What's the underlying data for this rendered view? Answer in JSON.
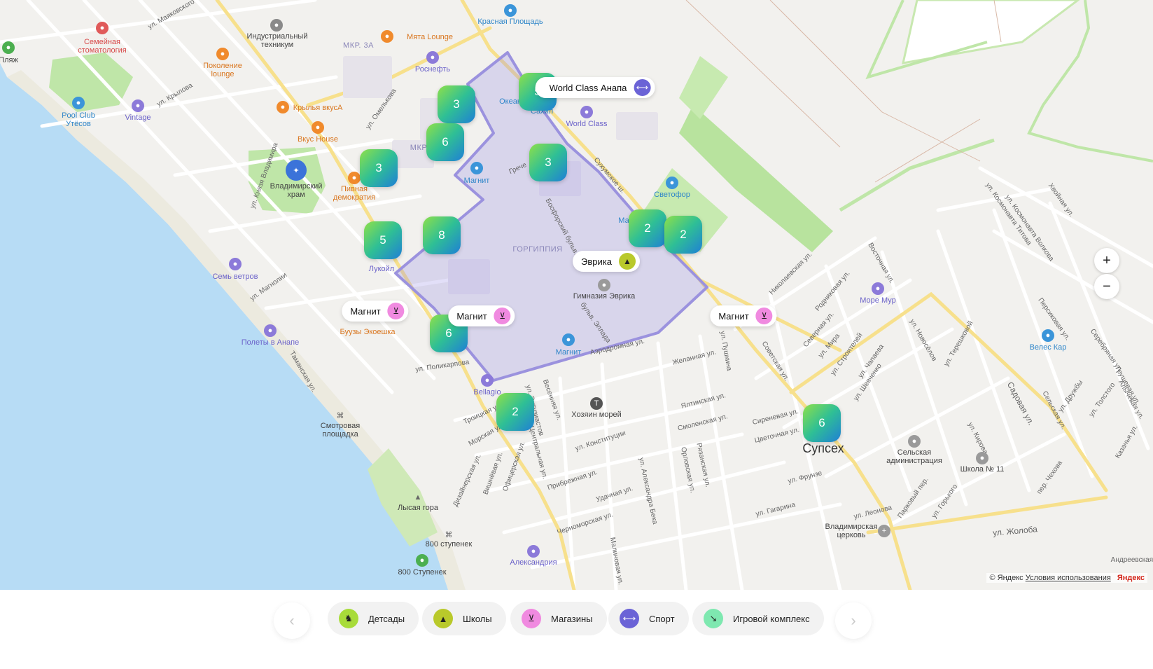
{
  "map": {
    "area_name": "ГОРГИППИЯ",
    "district": "Супсех",
    "clusters": [
      {
        "count": "5"
      },
      {
        "count": "3"
      },
      {
        "count": "6"
      },
      {
        "count": "3"
      },
      {
        "count": "3"
      },
      {
        "count": "5"
      },
      {
        "count": "8"
      },
      {
        "count": "2"
      },
      {
        "count": "2"
      },
      {
        "count": "6"
      },
      {
        "count": "2"
      },
      {
        "count": "6"
      }
    ],
    "tags": [
      {
        "label": "World Class Анапа",
        "icon": "dumbbell-icon",
        "color": "#6b63d6"
      },
      {
        "label": "Эврика",
        "icon": "graduation-cap-icon",
        "color": "#b9c92b"
      },
      {
        "label": "Магнит",
        "icon": "cart-icon",
        "color": "#f08ae0"
      },
      {
        "label": "Магнит",
        "icon": "cart-icon",
        "color": "#f08ae0"
      },
      {
        "label": "Магнит",
        "icon": "cart-icon",
        "color": "#f08ae0"
      }
    ],
    "labels": [
      "Красная Площадь",
      "Мята Lounge",
      "Индустриальный техникум",
      "Семейная стоматология",
      "Поколение lounge",
      "Роснефть",
      "Крылья вкусА",
      "Вкус House",
      "Pool Club Утёсов",
      "Vintage",
      "Владимирский храм",
      "Пивная демократия",
      "Лукойл",
      "Семь ветров",
      "Буузы Экоешка",
      "Полеты в Анапе",
      "Смотровая площадка",
      "Лысая гора",
      "800 ступенек",
      "800 Ступенек",
      "Александрия",
      "Bellagio",
      "Хозяин морей",
      "Магнит",
      "Магнит",
      "Гимназия Эврика",
      "Светофор",
      "World Class",
      "Океан",
      "Сахил",
      "Море Мур",
      "Велес Кар",
      "Сельская администрация",
      "Школа № 11",
      "Владимирская церковь",
      "МКР. 3А",
      "Пляж",
      "Маг",
      "Грече",
      "МКР"
    ],
    "streets": [
      "ул. Маяковского",
      "ул. Крылова",
      "ул. Омелькова",
      "ул. Князя Владимира",
      "ул. Магнолии",
      "Таманская ул.",
      "ул. Поликарпова",
      "Троицкая ул.",
      "Морская ул.",
      "Весенняя ул.",
      "ул. Энтузиастов",
      "Центральная ул.",
      "Офицерская ул.",
      "Вишнёвая ул.",
      "Дизайнерская ул.",
      "Прибрежная ул.",
      "ул. Конституции",
      "Удачная ул.",
      "Черноморская ул.",
      "Малиновая ул.",
      "ул. Александра Бека",
      "Орловская ул.",
      "Рязанская ул.",
      "Смоленская ул.",
      "Ялтинская ул.",
      "Желанная ул.",
      "ул. Пушкина",
      "Советская ул.",
      "Аэродромная ул.",
      "бульв. Эллада",
      "Босфорский бульв.",
      "Сухумское ш.",
      "Николаевская ул.",
      "Родниковая ул.",
      "Северная ул.",
      "ул. Мира",
      "ул. Строителей",
      "ул. Чапаева",
      "ул. Шевченко",
      "Восточная ул.",
      "ул. Новосёлов",
      "ул. Терешковой",
      "Сиреневая ул.",
      "Цветочная ул.",
      "ул. Фрунзе",
      "ул. Гагарина",
      "ул. Леонова",
      "ул. Жолоба",
      "Садовая ул.",
      "Сельская ул.",
      "ул. Кирова",
      "ул. Горького",
      "Парковый пер.",
      "пер. Чехова",
      "ул. Дружбы",
      "ул. Толстого",
      "Грушевая ул.",
      "Алычёвая ул.",
      "Казачья ул.",
      "Персиковая ул.",
      "Серебряная ул.",
      "ул. Космонавта Титова",
      "ул. Космонавта Волкова",
      "Хвойная ул.",
      "Андреевская ул."
    ],
    "zoom_in": "+",
    "zoom_out": "−",
    "copyright": "© Яндекс",
    "terms": "Условия использования",
    "brand": "Яндекс"
  },
  "filters": {
    "prev": "‹",
    "next": "›",
    "chips": [
      {
        "label": "Детсады",
        "icon": "rocking-horse-icon",
        "color": "#a8dc3a"
      },
      {
        "label": "Школы",
        "icon": "graduation-cap-icon",
        "color": "#b9c92b"
      },
      {
        "label": "Магазины",
        "icon": "cart-icon",
        "color": "#f08ae0"
      },
      {
        "label": "Спорт",
        "icon": "dumbbell-icon",
        "color": "#6b63d6"
      },
      {
        "label": "Игровой комплекс",
        "icon": "slide-icon",
        "color": "#7ee8b0"
      }
    ]
  }
}
